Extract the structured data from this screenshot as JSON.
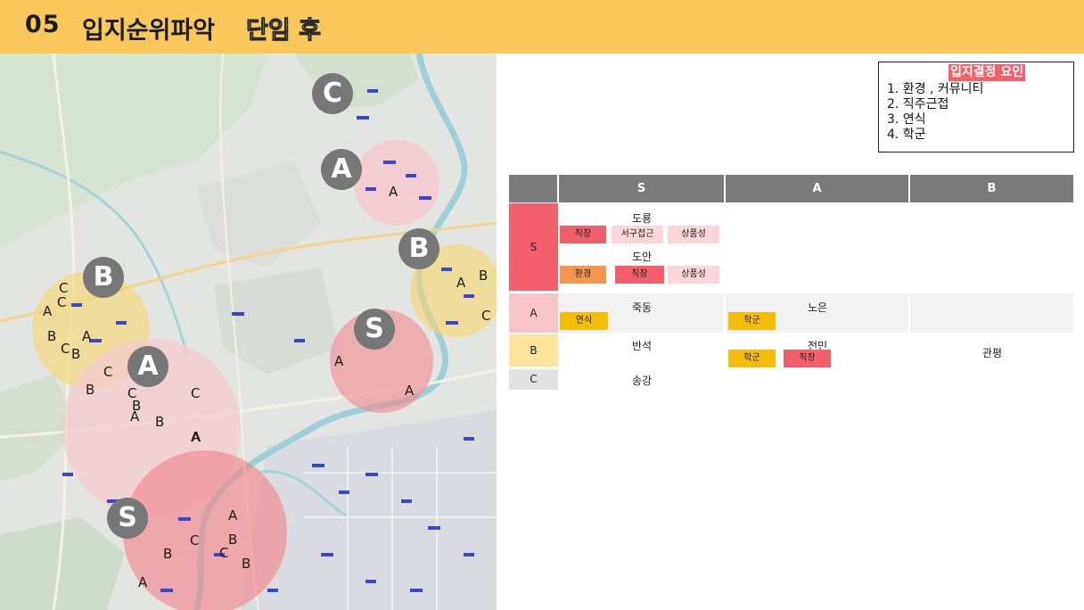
{
  "header": {
    "number": "05",
    "title": "입지순위파악",
    "subtitle": "단임 후"
  },
  "legend": {
    "title": "입지결정 요인",
    "items": [
      "1. 환경 , 커뮤니티",
      "2. 직주근접",
      "3. 연식",
      "4. 학군"
    ]
  },
  "colors": {
    "header": "#f8c95a",
    "red_tag": "#f35f6b",
    "pink_tag": "#fbd5d8",
    "orange_tag": "#f4964f",
    "gold_tag": "#f5bd0a",
    "grade_s": "#f35f6b",
    "grade_a": "#f9c4c8",
    "grade_b": "#fde49a",
    "grade_c": "#e2e2e2"
  },
  "map": {
    "badges": [
      "C",
      "A",
      "B",
      "B",
      "S",
      "A",
      "S"
    ],
    "labels": [
      "A",
      "A",
      "B",
      "C",
      "C",
      "A",
      "B",
      "C",
      "B",
      "A",
      "B",
      "C",
      "C",
      "B",
      "A",
      "C",
      "B",
      "A",
      "A",
      "A",
      "A",
      "B",
      "C",
      "B",
      "C",
      "B",
      "A",
      "A",
      "S"
    ]
  },
  "table": {
    "headers": [
      "",
      "S",
      "A",
      "B"
    ],
    "rows": [
      {
        "grade": "S",
        "s_places": [
          {
            "name": "도룡",
            "tags": [
              "직장",
              "서구접근",
              "상품성"
            ]
          },
          {
            "name": "도안",
            "tags": [
              "환경",
              "직장",
              "상품성"
            ]
          }
        ]
      },
      {
        "grade": "A",
        "s_place": "죽동",
        "s_tags": [
          "연식"
        ],
        "a_place": "노은",
        "a_tags": [
          "학군"
        ]
      },
      {
        "grade": "B",
        "s_place": "반석",
        "a_place": "전민",
        "a_tags": [
          "학군",
          "직장"
        ],
        "b_place": "관평"
      },
      {
        "grade": "C",
        "s_place": "송강"
      }
    ]
  }
}
